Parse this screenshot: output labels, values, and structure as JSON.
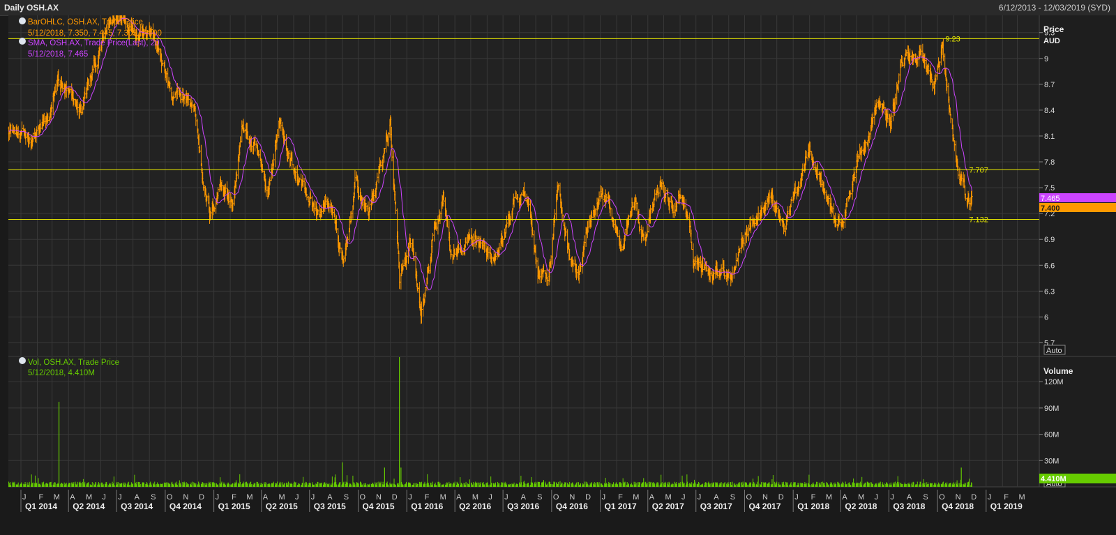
{
  "header": {
    "title": "Daily OSH.AX",
    "date_range": "6/12/2013 - 12/03/2019 (SYD)"
  },
  "legend": {
    "price": {
      "line1": "BarOHLC, OSH.AX, Trade Price",
      "line2": "5/12/2018, 7.350, 7.445, 7.305, 7.400",
      "color": "#ff9900"
    },
    "sma": {
      "line1": "SMA, OSH.AX, Trade Price(Last),  20",
      "line2": "5/12/2018, 7.465",
      "color": "#cc44ff"
    },
    "volume": {
      "line1": "Vol, OSH.AX, Trade Price",
      "line2": "5/12/2018, 4.410M",
      "color": "#66cc00"
    }
  },
  "axes": {
    "price_title": "Price",
    "price_unit": "AUD",
    "volume_title": "Volume",
    "auto_label_price": "Auto",
    "auto_label_volume": "Auto"
  },
  "badges": {
    "sma_last": "7.465",
    "close_last": "7.400",
    "volume_last": "4.410M"
  },
  "colors": {
    "background": "#222222",
    "grid": "#3a3a3a",
    "price_bars": "#ff9900",
    "sma_line": "#cc44ff",
    "volume_bars": "#66cc00",
    "hlines": "#e6e600"
  },
  "chart_data": [
    {
      "type": "ohlc",
      "series_label": "BarOHLC, OSH.AX, Trade Price",
      "ylim": [
        5.55,
        9.5
      ],
      "yticks": [
        5.7,
        6,
        6.3,
        6.6,
        6.9,
        7.2,
        7.5,
        7.8,
        8.1,
        8.4,
        8.7,
        9,
        9.3
      ],
      "ytick_labels": [
        "5.7",
        "6",
        "6.3",
        "6.6",
        "6.9",
        "7.2",
        "7.5",
        "7.8",
        "8.1",
        "8.4",
        "8.7",
        "9",
        "9.3"
      ],
      "horizontal_lines": [
        {
          "value": 9.23,
          "label": "9.23"
        },
        {
          "value": 7.707,
          "label": "7.707"
        },
        {
          "value": 7.132,
          "label": "7.132"
        }
      ],
      "last_bar": {
        "date": "5/12/2018",
        "open": 7.35,
        "high": 7.445,
        "low": 7.305,
        "close": 7.4
      },
      "sma_period": 20,
      "sma_last": 7.465,
      "x_start": "2014-01-01",
      "x_end": "2019-04-01",
      "anchors": [
        [
          "2013-12-06",
          8.25
        ],
        [
          "2014-01-05",
          8.05
        ],
        [
          "2014-02-01",
          8.15
        ],
        [
          "2014-02-25",
          8.3
        ],
        [
          "2014-03-12",
          8.75
        ],
        [
          "2014-04-05",
          8.5
        ],
        [
          "2014-04-25",
          8.4
        ],
        [
          "2014-05-20",
          8.9
        ],
        [
          "2014-06-15",
          9.35
        ],
        [
          "2014-07-01",
          9.5
        ],
        [
          "2014-07-20",
          9.45
        ],
        [
          "2014-08-10",
          9.35
        ],
        [
          "2014-09-01",
          9.4
        ],
        [
          "2014-09-25",
          8.95
        ],
        [
          "2014-10-15",
          8.5
        ],
        [
          "2014-11-05",
          8.55
        ],
        [
          "2014-11-25",
          8.45
        ],
        [
          "2014-12-10",
          7.7
        ],
        [
          "2014-12-25",
          7.15
        ],
        [
          "2015-01-15",
          7.6
        ],
        [
          "2015-02-05",
          7.3
        ],
        [
          "2015-02-25",
          8.2
        ],
        [
          "2015-03-25",
          7.85
        ],
        [
          "2015-04-12",
          7.4
        ],
        [
          "2015-05-05",
          8.3
        ],
        [
          "2015-05-28",
          7.75
        ],
        [
          "2015-06-20",
          7.5
        ],
        [
          "2015-07-15",
          7.2
        ],
        [
          "2015-08-10",
          7.35
        ],
        [
          "2015-09-03",
          6.55
        ],
        [
          "2015-09-25",
          7.55
        ],
        [
          "2015-10-20",
          7.2
        ],
        [
          "2015-11-10",
          7.7
        ],
        [
          "2015-12-01",
          8.25
        ],
        [
          "2015-12-18",
          6.4
        ],
        [
          "2016-01-10",
          6.8
        ],
        [
          "2016-01-28",
          6.0
        ],
        [
          "2016-02-20",
          6.85
        ],
        [
          "2016-03-10",
          7.4
        ],
        [
          "2016-03-25",
          6.7
        ],
        [
          "2016-04-15",
          6.75
        ],
        [
          "2016-05-10",
          6.95
        ],
        [
          "2016-06-10",
          6.7
        ],
        [
          "2016-07-01",
          6.85
        ],
        [
          "2016-07-25",
          7.35
        ],
        [
          "2016-08-15",
          7.4
        ],
        [
          "2016-09-05",
          6.55
        ],
        [
          "2016-09-25",
          6.5
        ],
        [
          "2016-10-12",
          7.5
        ],
        [
          "2016-11-01",
          6.8
        ],
        [
          "2016-11-20",
          6.45
        ],
        [
          "2016-12-10",
          7.05
        ],
        [
          "2017-01-10",
          7.35
        ],
        [
          "2017-02-10",
          6.9
        ],
        [
          "2017-03-05",
          7.35
        ],
        [
          "2017-03-25",
          6.95
        ],
        [
          "2017-04-25",
          7.5
        ],
        [
          "2017-05-20",
          7.25
        ],
        [
          "2017-06-05",
          7.45
        ],
        [
          "2017-06-25",
          6.7
        ],
        [
          "2017-07-20",
          6.55
        ],
        [
          "2017-08-15",
          6.6
        ],
        [
          "2017-09-05",
          6.5
        ],
        [
          "2017-09-25",
          6.9
        ],
        [
          "2017-10-25",
          7.2
        ],
        [
          "2017-11-20",
          7.4
        ],
        [
          "2017-12-15",
          7.1
        ],
        [
          "2018-01-10",
          7.5
        ],
        [
          "2018-02-01",
          8.05
        ],
        [
          "2018-02-25",
          7.55
        ],
        [
          "2018-03-20",
          7.15
        ],
        [
          "2018-04-05",
          7.1
        ],
        [
          "2018-04-25",
          7.65
        ],
        [
          "2018-05-20",
          8.05
        ],
        [
          "2018-06-10",
          8.45
        ],
        [
          "2018-07-05",
          8.25
        ],
        [
          "2018-07-25",
          8.95
        ],
        [
          "2018-08-15",
          9.05
        ],
        [
          "2018-09-05",
          9.0
        ],
        [
          "2018-09-25",
          8.7
        ],
        [
          "2018-10-10",
          9.15
        ],
        [
          "2018-10-25",
          8.3
        ],
        [
          "2018-11-08",
          7.7
        ],
        [
          "2018-11-25",
          7.35
        ],
        [
          "2018-12-05",
          7.4
        ]
      ]
    },
    {
      "type": "bar",
      "series_label": "Vol, OSH.AX, Trade Price",
      "ylim": [
        0,
        148
      ],
      "yticks": [
        30,
        60,
        90,
        120
      ],
      "ytick_labels": [
        "30M",
        "60M",
        "90M",
        "120M"
      ],
      "last_value_M": 4.41,
      "typical_value_M": 4,
      "spikes": [
        {
          "date": "2014-03-14",
          "value_M": 97
        },
        {
          "date": "2015-09-01",
          "value_M": 28
        },
        {
          "date": "2015-11-20",
          "value_M": 22
        },
        {
          "date": "2015-12-18",
          "value_M": 158
        },
        {
          "date": "2015-12-21",
          "value_M": 22
        },
        {
          "date": "2018-11-15",
          "value_M": 22
        }
      ]
    }
  ],
  "x_axis": {
    "months": [
      [
        "2014-01-01",
        "J"
      ],
      [
        "2014-02-01",
        "F"
      ],
      [
        "2014-03-01",
        "M"
      ],
      [
        "2014-04-01",
        "A"
      ],
      [
        "2014-05-01",
        "M"
      ],
      [
        "2014-06-01",
        "J"
      ],
      [
        "2014-07-01",
        "J"
      ],
      [
        "2014-08-01",
        "A"
      ],
      [
        "2014-09-01",
        "S"
      ],
      [
        "2014-10-01",
        "O"
      ],
      [
        "2014-11-01",
        "N"
      ],
      [
        "2014-12-01",
        "D"
      ],
      [
        "2015-01-01",
        "J"
      ],
      [
        "2015-02-01",
        "F"
      ],
      [
        "2015-03-01",
        "M"
      ],
      [
        "2015-04-01",
        "A"
      ],
      [
        "2015-05-01",
        "M"
      ],
      [
        "2015-06-01",
        "J"
      ],
      [
        "2015-07-01",
        "J"
      ],
      [
        "2015-08-01",
        "A"
      ],
      [
        "2015-09-01",
        "S"
      ],
      [
        "2015-10-01",
        "O"
      ],
      [
        "2015-11-01",
        "N"
      ],
      [
        "2015-12-01",
        "D"
      ],
      [
        "2016-01-01",
        "J"
      ],
      [
        "2016-02-01",
        "F"
      ],
      [
        "2016-03-01",
        "M"
      ],
      [
        "2016-04-01",
        "A"
      ],
      [
        "2016-05-01",
        "M"
      ],
      [
        "2016-06-01",
        "J"
      ],
      [
        "2016-07-01",
        "J"
      ],
      [
        "2016-08-01",
        "A"
      ],
      [
        "2016-09-01",
        "S"
      ],
      [
        "2016-10-01",
        "O"
      ],
      [
        "2016-11-01",
        "N"
      ],
      [
        "2016-12-01",
        "D"
      ],
      [
        "2017-01-01",
        "J"
      ],
      [
        "2017-02-01",
        "F"
      ],
      [
        "2017-03-01",
        "M"
      ],
      [
        "2017-04-01",
        "A"
      ],
      [
        "2017-05-01",
        "M"
      ],
      [
        "2017-06-01",
        "J"
      ],
      [
        "2017-07-01",
        "J"
      ],
      [
        "2017-08-01",
        "A"
      ],
      [
        "2017-09-01",
        "S"
      ],
      [
        "2017-10-01",
        "O"
      ],
      [
        "2017-11-01",
        "N"
      ],
      [
        "2017-12-01",
        "D"
      ],
      [
        "2018-01-01",
        "J"
      ],
      [
        "2018-02-01",
        "F"
      ],
      [
        "2018-03-01",
        "M"
      ],
      [
        "2018-04-01",
        "A"
      ],
      [
        "2018-05-01",
        "M"
      ],
      [
        "2018-06-01",
        "J"
      ],
      [
        "2018-07-01",
        "J"
      ],
      [
        "2018-08-01",
        "A"
      ],
      [
        "2018-09-01",
        "S"
      ],
      [
        "2018-10-01",
        "O"
      ],
      [
        "2018-11-01",
        "N"
      ],
      [
        "2018-12-01",
        "D"
      ],
      [
        "2019-01-01",
        "J"
      ],
      [
        "2019-02-01",
        "F"
      ],
      [
        "2019-03-01",
        "M"
      ]
    ],
    "quarters": [
      [
        "2014-01-01",
        "Q1 2014"
      ],
      [
        "2014-04-01",
        "Q2 2014"
      ],
      [
        "2014-07-01",
        "Q3 2014"
      ],
      [
        "2014-10-01",
        "Q4 2014"
      ],
      [
        "2015-01-01",
        "Q1 2015"
      ],
      [
        "2015-04-01",
        "Q2 2015"
      ],
      [
        "2015-07-01",
        "Q3 2015"
      ],
      [
        "2015-10-01",
        "Q4 2015"
      ],
      [
        "2016-01-01",
        "Q1 2016"
      ],
      [
        "2016-04-01",
        "Q2 2016"
      ],
      [
        "2016-07-01",
        "Q3 2016"
      ],
      [
        "2016-10-01",
        "Q4 2016"
      ],
      [
        "2017-01-01",
        "Q1 2017"
      ],
      [
        "2017-04-01",
        "Q2 2017"
      ],
      [
        "2017-07-01",
        "Q3 2017"
      ],
      [
        "2017-10-01",
        "Q4 2017"
      ],
      [
        "2018-01-01",
        "Q1 2018"
      ],
      [
        "2018-04-01",
        "Q2 2018"
      ],
      [
        "2018-07-01",
        "Q3 2018"
      ],
      [
        "2018-10-01",
        "Q4 2018"
      ],
      [
        "2019-01-01",
        "Q1 2019"
      ]
    ]
  }
}
